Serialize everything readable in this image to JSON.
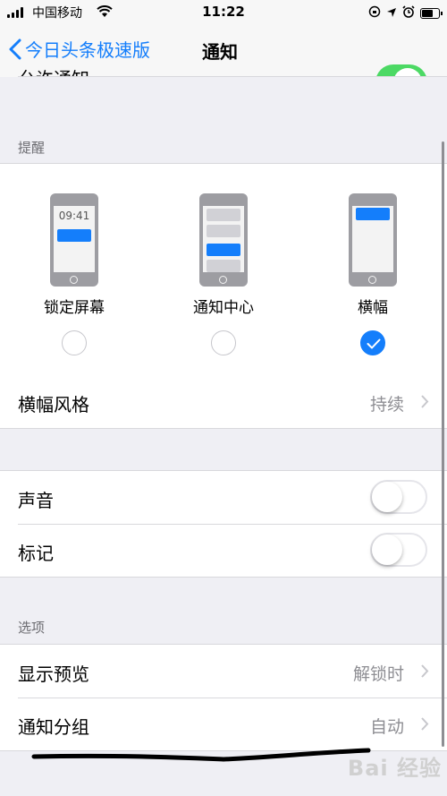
{
  "status_bar": {
    "carrier": "中国移动",
    "time": "11:22"
  },
  "nav": {
    "back_label": "今日头条极速版",
    "title": "通知"
  },
  "alerts_section": {
    "header": "提醒",
    "styles": [
      {
        "label": "锁定屏幕",
        "preview_time": "09:41",
        "selected": false
      },
      {
        "label": "通知中心",
        "selected": false
      },
      {
        "label": "横幅",
        "selected": true
      }
    ],
    "banner_style": {
      "label": "横幅风格",
      "value": "持续"
    }
  },
  "sound_section": {
    "rows": [
      {
        "label": "声音",
        "on": false
      },
      {
        "label": "标记",
        "on": false
      }
    ]
  },
  "options_section": {
    "header": "选项",
    "rows": [
      {
        "label": "显示预览",
        "value": "解锁时"
      },
      {
        "label": "通知分组",
        "value": "自动"
      }
    ]
  },
  "colors": {
    "accent": "#147efb",
    "toggle_on": "#4cd964",
    "background": "#efeff4",
    "secondary_text": "#8e8e93"
  },
  "watermark": "Bai 经验"
}
